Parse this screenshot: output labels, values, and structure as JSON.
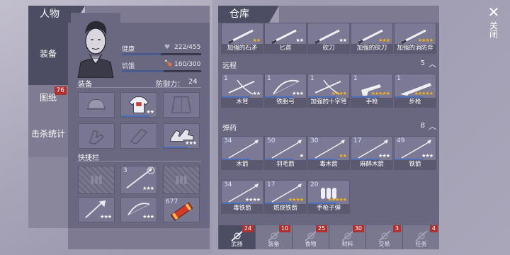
{
  "character": {
    "title": "人物",
    "tabs": [
      {
        "label": "装备",
        "badge": ""
      },
      {
        "label": "图纸",
        "badge": "76"
      },
      {
        "label": "击杀统计",
        "badge": ""
      }
    ],
    "health_label": "健康",
    "health_value": "222/455",
    "health_fraction": 0.49,
    "hunger_label": "饥饿",
    "hunger_value": "160/300",
    "hunger_fraction": 0.53,
    "equip_label": "装备",
    "defense_label": "防御力：",
    "defense_value": "24",
    "equip_slots": [
      {
        "icon": "helmet-icon",
        "stars": ""
      },
      {
        "icon": "shirt-icon",
        "stars": "★★"
      },
      {
        "icon": "jacket-icon",
        "stars": ""
      },
      {
        "icon": "gloves-icon",
        "stars": ""
      },
      {
        "icon": "pants-icon",
        "stars": ""
      },
      {
        "icon": "shoes-icon",
        "stars": "★★★"
      }
    ],
    "quickbar_label": "快捷栏",
    "quick_slots": [
      {
        "icon": "empty-slot",
        "count": "",
        "stars": ""
      },
      {
        "icon": "spear-icon",
        "count": "3",
        "stars": "★★★"
      },
      {
        "icon": "empty-slot",
        "count": "",
        "stars": ""
      },
      {
        "icon": "axe-icon",
        "count": "",
        "stars": "★★★"
      },
      {
        "icon": "bow-icon",
        "count": "",
        "stars": "★★★"
      },
      {
        "icon": "dynamite-icon",
        "count": "677",
        "stars": ""
      }
    ]
  },
  "warehouse": {
    "title": "仓库",
    "top_row": [
      {
        "name": "加强的石矛",
        "stars": "★★",
        "gold": true
      },
      {
        "name": "匕首",
        "stars": "★★",
        "gold": false
      },
      {
        "name": "砍刀",
        "stars": "★★",
        "gold": false
      },
      {
        "name": "加强的砍刀",
        "stars": "★★★",
        "gold": true
      },
      {
        "name": "加强的消防斧",
        "stars": "★★★★",
        "gold": true
      }
    ],
    "ranged": {
      "label": "远程",
      "count": "5",
      "items": [
        {
          "name": "木弩",
          "count": "1",
          "stars": "★★",
          "gold": false,
          "icon": "crossbow-icon"
        },
        {
          "name": "铁胎弓",
          "count": "1",
          "stars": "★★★",
          "gold": false,
          "icon": "bow-icon"
        },
        {
          "name": "加强的十字弩",
          "count": "1",
          "stars": "★★★★",
          "gold": true,
          "icon": "crossbow-icon"
        },
        {
          "name": "手枪",
          "count": "1",
          "stars": "★★★★★",
          "gold": true,
          "icon": "pistol-icon"
        },
        {
          "name": "步枪",
          "count": "1",
          "stars": "★★★★★",
          "gold": true,
          "icon": "rifle-icon"
        }
      ]
    },
    "ammo": {
      "label": "弹药",
      "count": "8",
      "items": [
        {
          "name": "木箭",
          "count": "34",
          "stars": "",
          "gold": false
        },
        {
          "name": "羽毛箭",
          "count": "50",
          "stars": "★",
          "gold": false
        },
        {
          "name": "毒木箭",
          "count": "30",
          "stars": "★★",
          "gold": true
        },
        {
          "name": "麻醉木箭",
          "count": "17",
          "stars": "★★★",
          "gold": false
        },
        {
          "name": "铁箭",
          "count": "49",
          "stars": "★★★",
          "gold": false
        },
        {
          "name": "毒铁箭",
          "count": "34",
          "stars": "★★★★",
          "gold": false
        },
        {
          "name": "燃烧铁箭",
          "count": "17",
          "stars": "★★★★",
          "gold": true
        },
        {
          "name": "手枪子弹",
          "count": "20",
          "stars": "★★★★★",
          "gold": true
        }
      ]
    },
    "bottom_tabs": [
      {
        "label": "武器",
        "count": "24",
        "icon": "weapon-icon"
      },
      {
        "label": "装备",
        "count": "10",
        "icon": "shirt-icon"
      },
      {
        "label": "食物",
        "count": "25",
        "icon": "food-icon"
      },
      {
        "label": "材料",
        "count": "30",
        "icon": "material-icon"
      },
      {
        "label": "交易",
        "count": "3",
        "icon": "trade-icon"
      },
      {
        "label": "任务",
        "count": "4",
        "icon": "quest-icon"
      }
    ]
  },
  "close_label": "关闭",
  "colors": {
    "panel": "#4c4c62",
    "star_gold": "#f4b51c",
    "badge": "#b03030",
    "bar_blue": "#4a6fb8"
  }
}
